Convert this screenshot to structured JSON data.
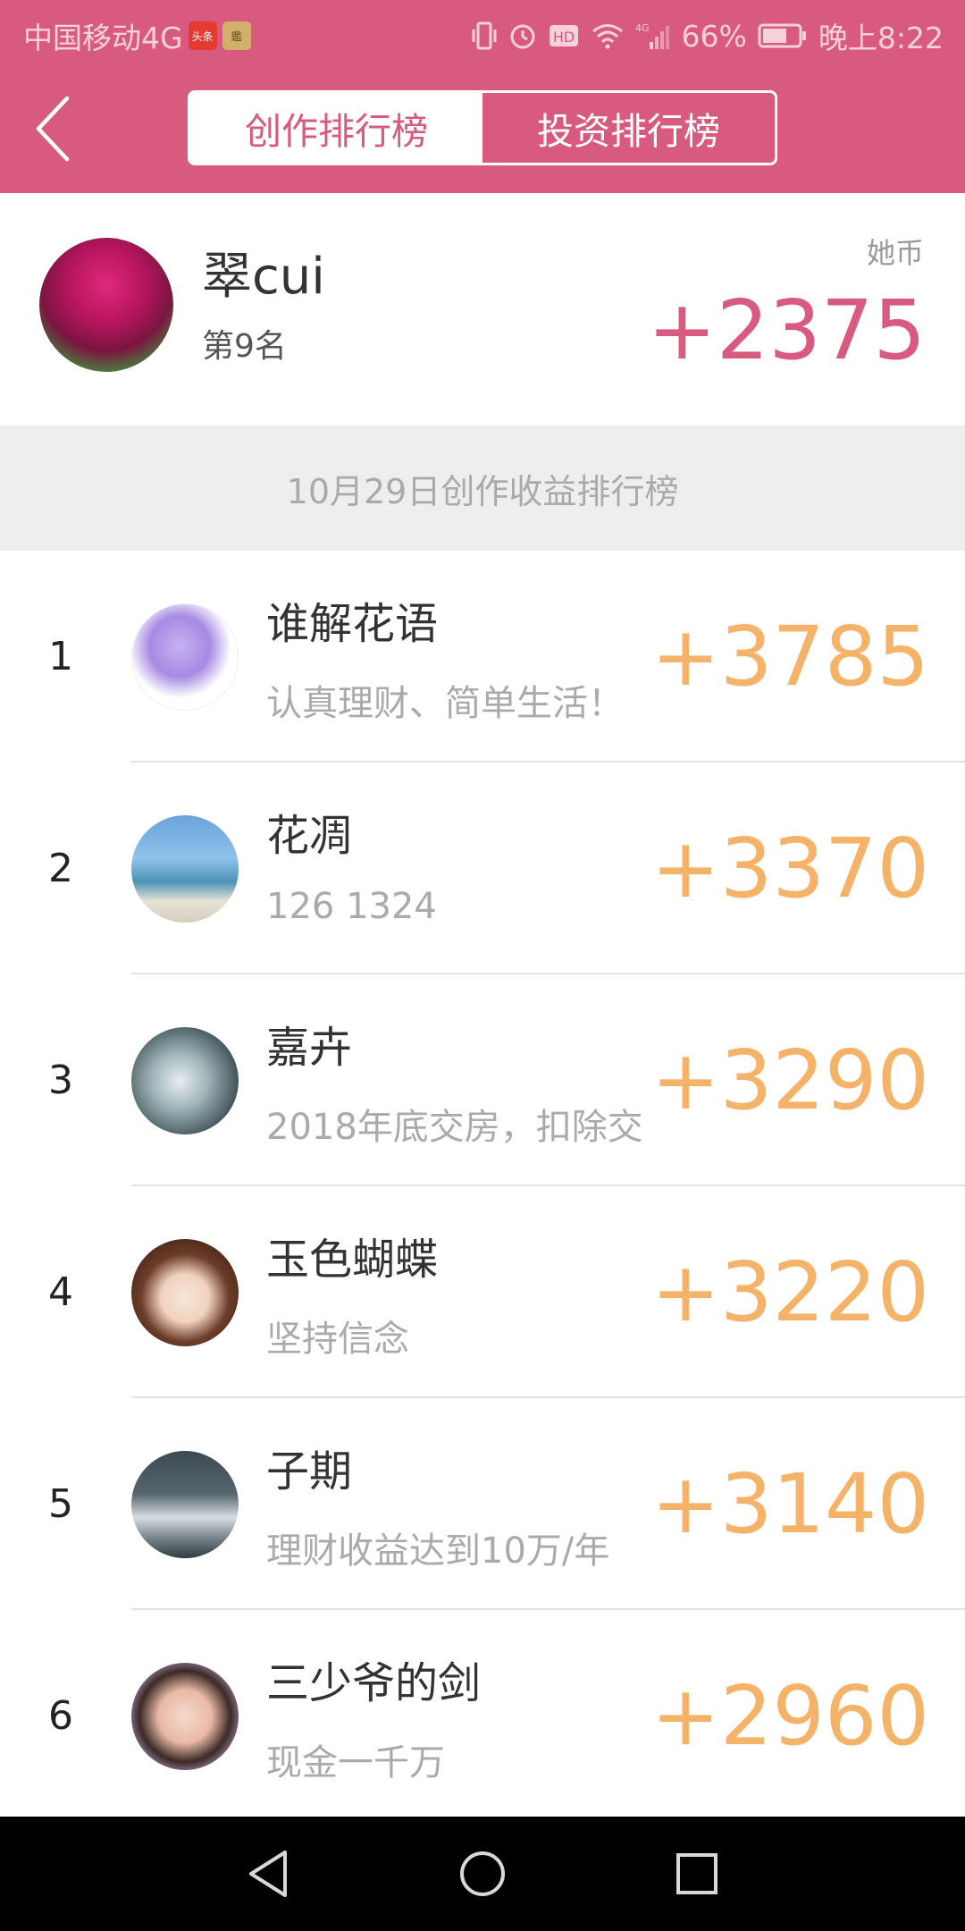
{
  "status_bar": {
    "carrier": "中国移动4G",
    "badge_1": "头条",
    "badge_2": "鑑",
    "network_type": "4G",
    "battery": "66%",
    "time": "晚上8:22"
  },
  "header": {
    "tabs": [
      {
        "label": "创作排行榜",
        "active": true
      },
      {
        "label": "投资排行榜",
        "active": false
      }
    ]
  },
  "me": {
    "name": "翠cui",
    "rank": "第9名",
    "coin_label": "她币",
    "score": "+2375"
  },
  "section": {
    "title": "10月29日创作收益排行榜"
  },
  "list": [
    {
      "rank": "1",
      "name": "谁解花语",
      "subtitle": "认真理财、简单生活！",
      "score": "+3785"
    },
    {
      "rank": "2",
      "name": "花凋",
      "subtitle": "126 1324",
      "score": "+3370"
    },
    {
      "rank": "3",
      "name": "嘉卉",
      "subtitle": "2018年底交房，扣除交",
      "score": "+3290"
    },
    {
      "rank": "4",
      "name": "玉色蝴蝶",
      "subtitle": "坚持信念",
      "score": "+3220"
    },
    {
      "rank": "5",
      "name": "子期",
      "subtitle": "理财收益达到10万/年",
      "score": "+3140"
    },
    {
      "rank": "6",
      "name": "三少爷的剑",
      "subtitle": "现金一千万",
      "score": "+2960"
    }
  ],
  "colors": {
    "brand": "#d95a7f",
    "score_orange": "#f5b36a"
  },
  "icons": {
    "back": "chevron-left-icon",
    "nav_back": "triangle-back-icon",
    "nav_home": "circle-home-icon",
    "nav_recents": "square-recents-icon"
  }
}
